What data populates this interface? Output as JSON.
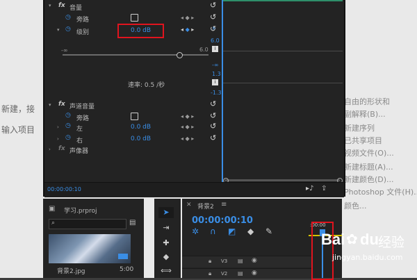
{
  "article": {
    "line1": "新建，接",
    "line2": "输入项目",
    "menu_right": [
      "自由的形状和",
      "副解释(B)...",
      "新建序列",
      "已共享项目",
      "视频文件(O)...",
      "新建标题(A)...",
      "新建颜色(D)...",
      "Photoshop 文件(H)...",
      "颜色..."
    ]
  },
  "effects": {
    "volume_header": "音量",
    "bypass_label": "旁路",
    "level_label": "级别",
    "level_value": "0.0 dB",
    "slider_min": "-∞",
    "slider_max": "6.0",
    "graph_labels": [
      "6.0",
      "-∞",
      "1.3",
      "-1.3"
    ],
    "velocity": "速率: 0.5 /秒",
    "channel_header": "声道音量",
    "channel_bypass": "旁路",
    "left_label": "左",
    "left_value": "0.0 dB",
    "right_label": "右",
    "right_value": "0.0 dB",
    "panner_label": "声像器",
    "timecode": "00:00:00:10"
  },
  "project": {
    "name": "学习.prproj",
    "clip_name": "背景2.jpg",
    "clip_duration": "5:00"
  },
  "timeline": {
    "tab_label": "背景2",
    "timecode": "00:00:00:10",
    "ruler_time": ":00:00",
    "tracks": [
      "V3",
      "V2"
    ]
  },
  "watermark": {
    "brand": "Bai",
    "brand2": "du",
    "jingyan": "经验",
    "url": "jingyan.baidu.com"
  },
  "colors": {
    "accent": "#3a8ee6",
    "highlight_box": "#e0141e"
  }
}
